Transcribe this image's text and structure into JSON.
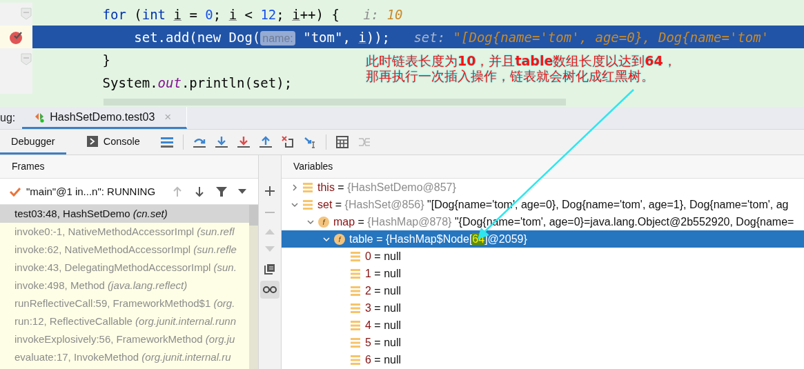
{
  "editor": {
    "lines": [
      {
        "breakpoint": false,
        "fold": true,
        "current": false,
        "tokens": [
          {
            "text": "        for",
            "kind": "keyword"
          },
          {
            "text": " (",
            "kind": "plain"
          },
          {
            "text": "int ",
            "kind": "keyword"
          },
          {
            "text": "i",
            "kind": "var"
          },
          {
            "text": " = ",
            "kind": "plain"
          },
          {
            "text": "0",
            "kind": "number"
          },
          {
            "text": "; ",
            "kind": "plain"
          },
          {
            "text": "i",
            "kind": "var"
          },
          {
            "text": " < ",
            "kind": "plain"
          },
          {
            "text": "12",
            "kind": "number"
          },
          {
            "text": "; ",
            "kind": "plain"
          },
          {
            "text": "i",
            "kind": "var"
          },
          {
            "text": "++) {   ",
            "kind": "plain"
          },
          {
            "text": "i: ",
            "kind": "debug-label"
          },
          {
            "text": "10",
            "kind": "debug-value"
          }
        ]
      },
      {
        "breakpoint": true,
        "fold": false,
        "current": true,
        "tokens": [
          {
            "text": "            set.add(new Dog(",
            "kind": "plain"
          },
          {
            "text": "name:",
            "kind": "hint"
          },
          {
            "text": " \"tom\", ",
            "kind": "plain"
          },
          {
            "text": "i",
            "kind": "var"
          },
          {
            "text": "));   ",
            "kind": "plain"
          },
          {
            "text": "set: ",
            "kind": "debug-label"
          },
          {
            "text": "\"[Dog{name='tom', age=0}, Dog{name='tom'",
            "kind": "debug-value"
          }
        ]
      },
      {
        "breakpoint": false,
        "fold": true,
        "current": false,
        "tokens": [
          {
            "text": "        }",
            "kind": "plain"
          }
        ]
      },
      {
        "breakpoint": false,
        "fold": false,
        "current": false,
        "tokens": [
          {
            "text": "        System.",
            "kind": "plain"
          },
          {
            "text": "out",
            "kind": "static"
          },
          {
            "text": ".println(set);",
            "kind": "plain"
          }
        ]
      }
    ]
  },
  "annotation": {
    "lines": [
      "此时链表长度为**10**，并且**table**数组长度以达到**64**，",
      "那再执行一次插入操作，链表就会树化成红黑树。"
    ]
  },
  "debug_bar": {
    "label": "ug:",
    "tab": "HashSetDemo.test03",
    "close": "×"
  },
  "tabs": [
    {
      "label": "Debugger",
      "selected": true
    },
    {
      "label": "Console",
      "selected": false
    }
  ],
  "frames": {
    "title": "Frames",
    "thread": "\"main\"@1 in...n\": RUNNING",
    "items": [
      {
        "method": "test03:48, HashSetDemo",
        "package": "(cn.set)",
        "selected": true,
        "library": false
      },
      {
        "method": "invoke0:-1, NativeMethodAccessorImpl",
        "package": "(sun.refl",
        "selected": false,
        "library": true
      },
      {
        "method": "invoke:62, NativeMethodAccessorImpl",
        "package": "(sun.refle",
        "selected": false,
        "library": true
      },
      {
        "method": "invoke:43, DelegatingMethodAccessorImpl",
        "package": "(sun.",
        "selected": false,
        "library": true
      },
      {
        "method": "invoke:498, Method",
        "package": "(java.lang.reflect)",
        "selected": false,
        "library": true
      },
      {
        "method": "runReflectiveCall:59, FrameworkMethod$1",
        "package": "(org.",
        "selected": false,
        "library": true
      },
      {
        "method": "run:12, ReflectiveCallable",
        "package": "(org.junit.internal.runn",
        "selected": false,
        "library": true
      },
      {
        "method": "invokeExplosively:56, FrameworkMethod",
        "package": "(org.ju",
        "selected": false,
        "library": true
      },
      {
        "method": "evaluate:17, InvokeMethod",
        "package": "(org.junit.internal.ru",
        "selected": false,
        "library": true
      }
    ]
  },
  "variables": {
    "title": "Variables",
    "items": [
      {
        "name": "this",
        "kind": "local",
        "eq": "=",
        "value": "{HashSetDemo@857}",
        "expanded": false,
        "selected": false
      },
      {
        "name": "set",
        "kind": "local",
        "eq": "=",
        "value": "{HashSet@856}",
        "preview": "\"[Dog{name='tom', age=0}, Dog{name='tom', age=1}, Dog{name='tom', ag",
        "expanded": true,
        "selected": false,
        "children": [
          {
            "name": "map",
            "kind": "field",
            "icon": "f",
            "eq": "=",
            "value": "{HashMap@878}",
            "preview": "\"{Dog{name='tom', age=0}=java.lang.Object@2b552920, Dog{name=",
            "expanded": true,
            "selected": false,
            "children": [
              {
                "name": "table",
                "kind": "field",
                "icon": "f",
                "eq": "=",
                "value_parts": [
                  {
                    "text": "{HashMap$Node[",
                    "highlighted": false
                  },
                  {
                    "text": "64",
                    "highlighted": true
                  },
                  {
                    "text": "]@2059}",
                    "highlighted": false
                  }
                ],
                "expanded": true,
                "selected": true,
                "children": [
                  {
                    "name": "0",
                    "kind": "element",
                    "eq": "=",
                    "value": "null",
                    "selected": false
                  },
                  {
                    "name": "1",
                    "kind": "element",
                    "eq": "=",
                    "value": "null",
                    "selected": false
                  },
                  {
                    "name": "2",
                    "kind": "element",
                    "eq": "=",
                    "value": "null",
                    "selected": false
                  },
                  {
                    "name": "3",
                    "kind": "element",
                    "eq": "=",
                    "value": "null",
                    "selected": false
                  },
                  {
                    "name": "4",
                    "kind": "element",
                    "eq": "=",
                    "value": "null",
                    "selected": false
                  },
                  {
                    "name": "5",
                    "kind": "element",
                    "eq": "=",
                    "value": "null",
                    "selected": false
                  },
                  {
                    "name": "6",
                    "kind": "element",
                    "eq": "=",
                    "value": "null",
                    "selected": false
                  }
                ]
              }
            ]
          }
        ]
      }
    ]
  }
}
